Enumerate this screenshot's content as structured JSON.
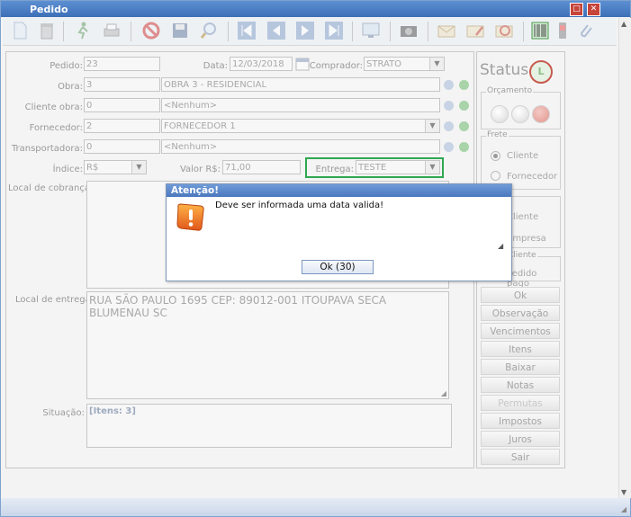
{
  "window": {
    "title": "Pedido",
    "controls": [
      "maximize",
      "close"
    ]
  },
  "toolbar": {
    "icons": [
      "new-document-icon",
      "delete-icon",
      "run-icon",
      "print-icon",
      "cancel-icon",
      "save-icon",
      "search-icon",
      "first-record-icon",
      "previous-record-icon",
      "next-record-icon",
      "last-record-icon",
      "screen-icon",
      "camera-icon",
      "mail-icon",
      "mail-edit-icon",
      "mail-send-icon",
      "barcode-icon",
      "phone-icon",
      "attach-icon"
    ]
  },
  "form": {
    "pedido": {
      "label": "Pedido:",
      "value": "23"
    },
    "data": {
      "label": "Data:",
      "value": "12/03/2018"
    },
    "comprador": {
      "label": "Comprador:",
      "value": "STRATO"
    },
    "obra": {
      "label": "Obra:",
      "code": "3",
      "name": "OBRA 3 - RESIDENCIAL"
    },
    "cliente_obra": {
      "label": "Cliente obra:",
      "code": "0",
      "name": "<Nenhum>"
    },
    "fornecedor": {
      "label": "Fornecedor:",
      "code": "2",
      "name": "FORNECEDOR 1"
    },
    "transportadora": {
      "label": "Transportadora:",
      "code": "0",
      "name": "<Nenhum>"
    },
    "indice": {
      "label": "Índice:",
      "value": "R$"
    },
    "valor": {
      "label": "Valor R$:",
      "value": "71,00"
    },
    "entrega": {
      "label": "Entrega:",
      "value": "TESTE"
    },
    "local_cobranca": {
      "label": "Local de cobrança:",
      "value": ""
    },
    "local_entrega": {
      "label": "Local de entrega:",
      "value": "RUA SÃO PAULO 1695 CEP: 89012-001 ITOUPAVA SECA BLUMENAU SC"
    },
    "situacao": {
      "label": "Situação:",
      "value": "[Itens: 3]"
    }
  },
  "side": {
    "status_title": "Status",
    "status_badge": "L",
    "orcamento_label": "Orçamento",
    "frete_label": "Frete",
    "frete_options": [
      "Cliente",
      "Fornecedor"
    ],
    "frete_selected": "Cliente",
    "entrega_options": [
      "Cliente",
      "Empresa"
    ],
    "cliente_group_label": "Cliente",
    "pedido_pago_label": "Pedido pago",
    "buttons": [
      "Ok",
      "Observação",
      "Vencimentos",
      "Itens",
      "Baixar",
      "Notas",
      "Permutas",
      "Impostos",
      "Juros",
      "Sair"
    ],
    "disabled_buttons": [
      "Permutas"
    ]
  },
  "dialog": {
    "title": "Atenção!",
    "message": "Deve ser informada uma data valida!",
    "ok_label": "Ok (30)"
  },
  "colors": {
    "accent": "#3d6fb8",
    "highlight": "#2fa84f",
    "close": "#c6443a"
  }
}
